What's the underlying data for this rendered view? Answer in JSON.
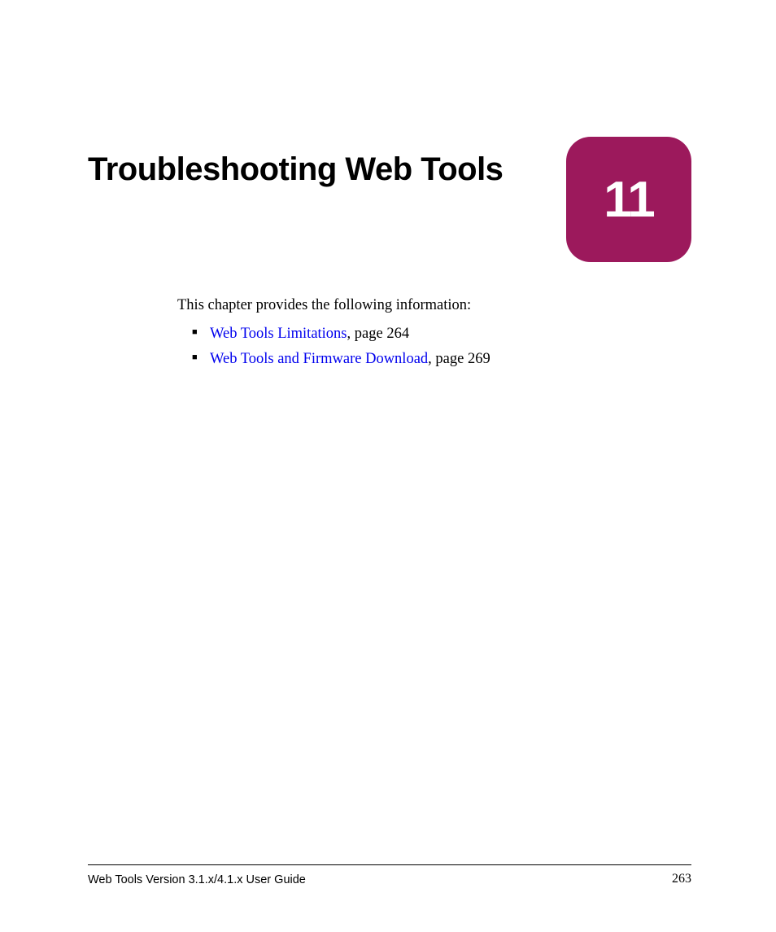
{
  "chapter": {
    "title": "Troubleshooting Web Tools",
    "number": "11"
  },
  "intro": "This chapter provides the following information:",
  "bullets": [
    {
      "link_text": "Web Tools Limitations",
      "suffix": ", page 264"
    },
    {
      "link_text": "Web Tools and Firmware Download",
      "suffix": ", page 269"
    }
  ],
  "footer": {
    "left": "Web Tools Version 3.1.x/4.1.x User Guide",
    "right": "263"
  }
}
